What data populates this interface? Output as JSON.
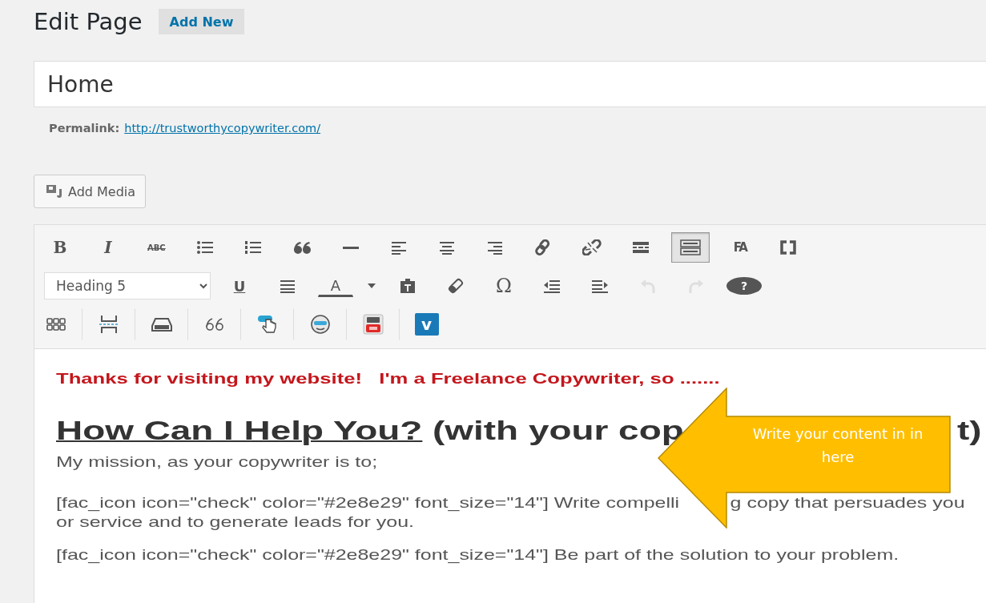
{
  "header": {
    "title": "Edit Page",
    "add_new": "Add New"
  },
  "title_field": {
    "value": "Home"
  },
  "permalink": {
    "label": "Permalink:",
    "url": "http://trustworthycopywriter.com/"
  },
  "add_media": {
    "label": "Add Media"
  },
  "toolbar": {
    "row_1": [
      {
        "kind": "bold",
        "label": "B",
        "pressed": false
      },
      {
        "kind": "italic",
        "label": "I",
        "pressed": false
      },
      {
        "kind": "strike",
        "label": "ABC",
        "pressed": false
      },
      {
        "kind": "bullets",
        "pressed": false
      },
      {
        "kind": "numbers",
        "pressed": false
      },
      {
        "kind": "quote",
        "pressed": false
      },
      {
        "kind": "hr",
        "pressed": false
      },
      {
        "kind": "align-left",
        "pressed": false
      },
      {
        "kind": "align-center",
        "pressed": false
      },
      {
        "kind": "align-right",
        "pressed": false
      },
      {
        "kind": "link",
        "pressed": false
      },
      {
        "kind": "unlink",
        "pressed": false
      },
      {
        "kind": "more",
        "pressed": false
      },
      {
        "kind": "toggle",
        "pressed": true
      },
      {
        "kind": "fa",
        "label": "FA",
        "pressed": false
      },
      {
        "kind": "brackets",
        "pressed": false
      }
    ],
    "row_2": {
      "format_select": {
        "value": "Heading 5"
      },
      "buttons": [
        {
          "kind": "underline",
          "label": "U",
          "disabled": false
        },
        {
          "kind": "justify",
          "disabled": false
        },
        {
          "kind": "text-color",
          "label": "A",
          "disabled": false
        },
        {
          "kind": "caret",
          "disabled": false
        },
        {
          "kind": "paste-text",
          "disabled": false
        },
        {
          "kind": "eraser",
          "disabled": false
        },
        {
          "kind": "omega",
          "label": "Ω",
          "disabled": false
        },
        {
          "kind": "outdent",
          "disabled": false
        },
        {
          "kind": "indent",
          "disabled": false
        },
        {
          "kind": "undo",
          "disabled": true
        },
        {
          "kind": "redo",
          "disabled": true
        },
        {
          "kind": "help",
          "label": "?",
          "disabled": false
        }
      ]
    },
    "row_3": [
      {
        "kind": "grid"
      },
      {
        "kind": "page-break"
      },
      {
        "kind": "inbox"
      },
      {
        "kind": "quote66"
      },
      {
        "kind": "pointer"
      },
      {
        "kind": "smiley"
      },
      {
        "kind": "video"
      },
      {
        "kind": "vimeo",
        "label": "v"
      }
    ]
  },
  "content": {
    "intro": "Thanks for visiting my website!   I'm a Freelance Copywriter, so .......",
    "heading": {
      "link": "How Can I Help You?",
      "before_arrow": " (with your cop",
      "after_arrow": "t)"
    },
    "paragraphs": [
      {
        "text": "My mission, as your copywriter is to;"
      },
      {
        "before_arrow": "[fac_icon icon=\"check\" color=\"#2e8e29\" font_size=\"14\"] Write compelli",
        "after_arrow": "g copy that persuades you",
        "line_2": "or service and to generate leads for you."
      },
      {
        "text": "[fac_icon icon=\"check\" color=\"#2e8e29\" font_size=\"14\"] Be part of the solution to your problem."
      }
    ]
  },
  "callout": {
    "text": "Write your content in in here"
  }
}
